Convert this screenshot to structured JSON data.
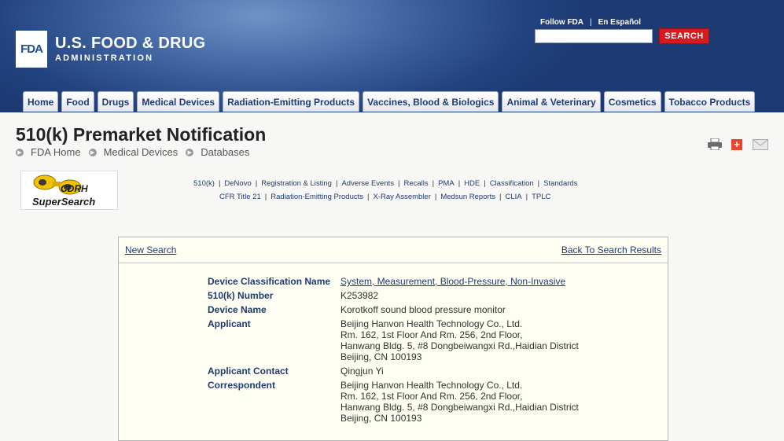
{
  "header": {
    "logo_box": "FDA",
    "logo_main": "U.S. FOOD & DRUG",
    "logo_sub": "ADMINISTRATION",
    "follow_link": "Follow FDA",
    "spanish_link": "En Español",
    "search_placeholder": "",
    "search_button": "SEARCH"
  },
  "nav": {
    "tabs": [
      "Home",
      "Food",
      "Drugs",
      "Medical Devices",
      "Radiation-Emitting Products",
      "Vaccines, Blood & Biologics",
      "Animal & Veterinary",
      "Cosmetics",
      "Tobacco Products"
    ]
  },
  "page": {
    "title": "510(k) Premarket Notification",
    "breadcrumb": [
      "FDA Home",
      "Medical Devices",
      "Databases"
    ]
  },
  "cdrh_logo": {
    "line1": "CDRH",
    "line2": "SuperSearch"
  },
  "links": {
    "row1": [
      "510(k)",
      "DeNovo",
      "Registration & Listing",
      "Adverse Events",
      "Recalls",
      "PMA",
      "HDE",
      "Classification",
      "Standards"
    ],
    "row2": [
      "CFR Title 21",
      "Radiation-Emitting Products",
      "X-Ray Assembler",
      "Medsun Reports",
      "CLIA",
      "TPLC"
    ]
  },
  "panel": {
    "new_search": "New Search",
    "back_results": "Back To Search Results",
    "fields": [
      {
        "label": "Device Classification Name",
        "value": [
          "System, Measurement, Blood-Pressure, Non-Invasive"
        ],
        "link": true
      },
      {
        "label": "510(k) Number",
        "value": [
          "K253982"
        ],
        "link": false
      },
      {
        "label": "Device Name",
        "value": [
          "Korotkoff sound blood pressure monitor"
        ],
        "link": false
      },
      {
        "label": "Applicant",
        "value": [
          "Beijing Hanvon Health Technology Co., Ltd.",
          "Rm. 162, 1st Floor And Rm. 256, 2nd Floor,",
          "Hanwang Bldg. 5, #8 Dongbeiwangxi Rd.,Haidian District",
          "Beijing,  CN 100193"
        ],
        "link": false
      },
      {
        "label": "Applicant Contact",
        "value": [
          "Qingjun Yi"
        ],
        "link": false
      },
      {
        "label": "Correspondent",
        "value": [
          "Beijing Hanvon Health Technology Co., Ltd.",
          "Rm. 162, 1st Floor And Rm. 256, 2nd Floor,",
          "Hanwang Bldg. 5, #8 Dongbeiwangxi Rd.,Haidian District",
          "Beijing,  CN 100193"
        ],
        "link": false
      }
    ]
  },
  "icons": {
    "print": "printer-icon",
    "share": "plus-icon",
    "email": "envelope-icon"
  }
}
